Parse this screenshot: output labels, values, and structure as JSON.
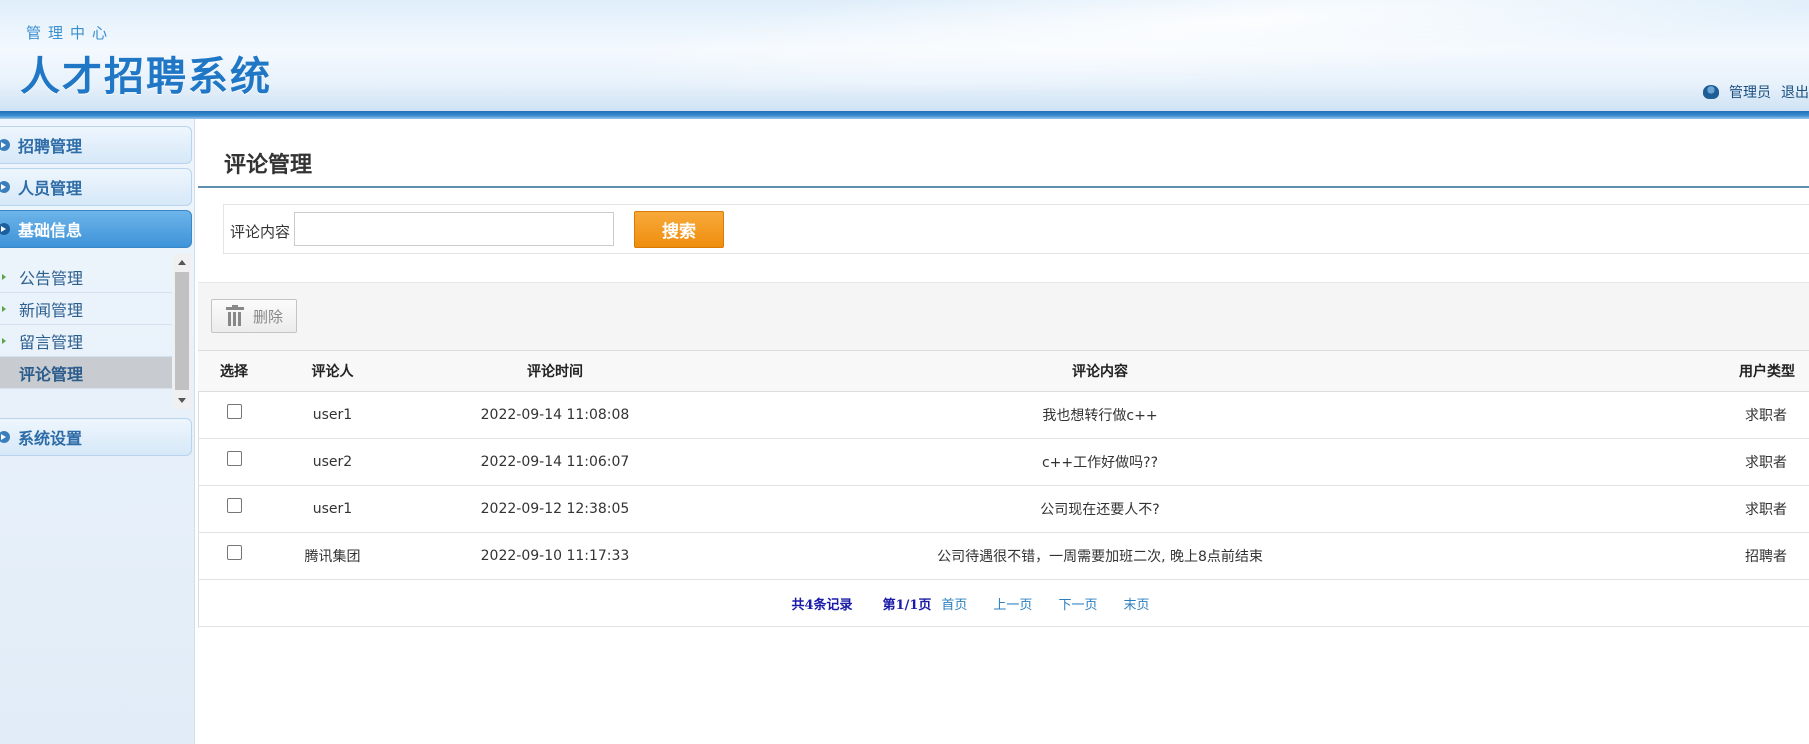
{
  "header": {
    "subtitle": "管理中心",
    "title": "人才招聘系统",
    "user_label": "管理员",
    "logout_label": "退出"
  },
  "sidebar": {
    "groups": [
      {
        "label": "招聘管理"
      },
      {
        "label": "人员管理"
      },
      {
        "label": "基础信息",
        "active": true
      },
      {
        "label": "系统设置"
      }
    ],
    "submenu": [
      {
        "label": "公告管理"
      },
      {
        "label": "新闻管理"
      },
      {
        "label": "留言管理"
      },
      {
        "label": "评论管理",
        "active": true
      }
    ]
  },
  "main": {
    "page_title": "评论管理",
    "search": {
      "label": "评论内容",
      "value": "",
      "button_label": "搜索"
    },
    "toolbar": {
      "delete_label": "删除"
    },
    "table": {
      "headers": [
        "选择",
        "评论人",
        "评论时间",
        "评论内容",
        "用户类型"
      ],
      "rows": [
        {
          "user": "user1",
          "time": "2022-09-14 11:08:08",
          "content": "我也想转行做c++",
          "type": "求职者"
        },
        {
          "user": "user2",
          "time": "2022-09-14 11:06:07",
          "content": "c++工作好做吗??",
          "type": "求职者"
        },
        {
          "user": "user1",
          "time": "2022-09-12 12:38:05",
          "content": "公司现在还要人不?",
          "type": "求职者"
        },
        {
          "user": "腾讯集团",
          "time": "2022-09-10 11:17:33",
          "content": "公司待遇很不错，一周需要加班二次, 晚上8点前结束",
          "type": "招聘者"
        }
      ]
    },
    "pager": {
      "total": "共4条记录",
      "page_info": "第1/1页",
      "first": "首页",
      "prev": "上一页",
      "next": "下一页",
      "last": "末页"
    }
  },
  "colors": {
    "accent_blue": "#1f77c6",
    "search_orange": "#f29a1f",
    "active_menu": "#4a9ee0"
  }
}
